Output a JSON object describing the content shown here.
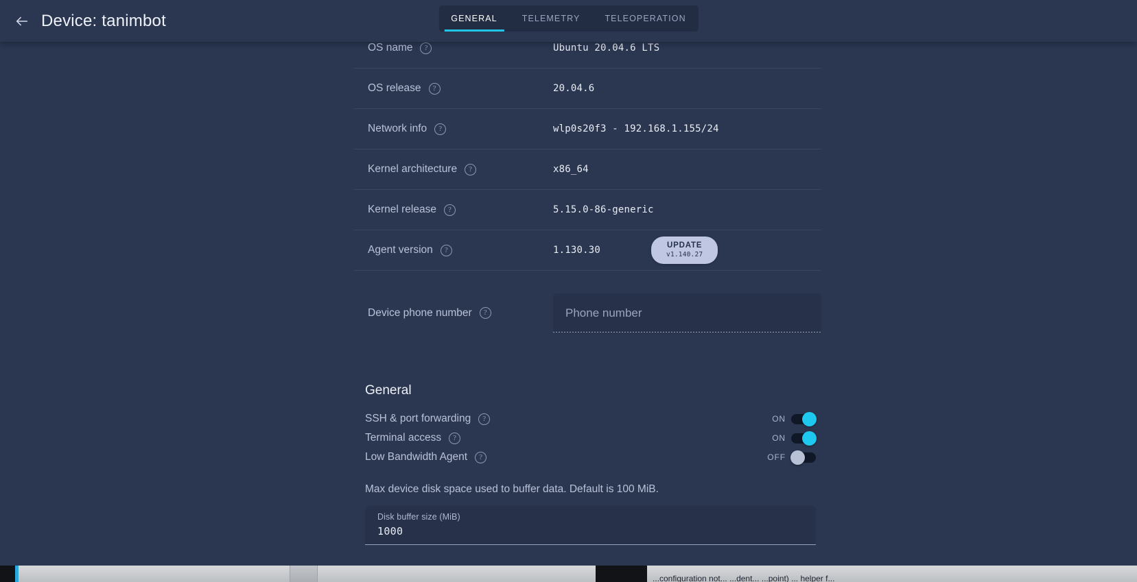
{
  "header": {
    "back_icon": "arrow-left-icon",
    "title": "Device: tanimbot",
    "tabs": [
      {
        "label": "GENERAL",
        "active": true
      },
      {
        "label": "TELEMETRY",
        "active": false
      },
      {
        "label": "TELEOPERATION",
        "active": false
      }
    ]
  },
  "info_rows": [
    {
      "label": "OS name",
      "value": "Ubuntu 20.04.6 LTS"
    },
    {
      "label": "OS release",
      "value": "20.04.6"
    },
    {
      "label": "Network info",
      "value": "wlp0s20f3 - 192.168.1.155/24"
    },
    {
      "label": "Kernel architecture",
      "value": "x86_64"
    },
    {
      "label": "Kernel release",
      "value": "5.15.0-86-generic"
    },
    {
      "label": "Agent version",
      "value": "1.130.30"
    }
  ],
  "agent_update": {
    "button_label": "UPDATE",
    "button_version": "v1.140.27"
  },
  "phone": {
    "label": "Device phone number",
    "value": "",
    "placeholder": "Phone number"
  },
  "general_section": {
    "title": "General",
    "toggles": [
      {
        "label": "SSH & port forwarding",
        "state": "ON",
        "on": true
      },
      {
        "label": "Terminal access",
        "state": "ON",
        "on": true
      },
      {
        "label": "Low Bandwidth Agent",
        "state": "OFF",
        "on": false
      }
    ],
    "buffer_hint": "Max device disk space used to buffer data. Default is 100 MiB.",
    "buffer_caption": "Disk buffer size (MiB)",
    "buffer_value": "1000"
  },
  "taskbar": {
    "clipped_text": "...configuration not... ...dent... ...point) ... helper f..."
  },
  "colors": {
    "page_background": "#2b3751",
    "tabs_background": "#222c42",
    "accent_cyan": "#22c7e8",
    "update_button": "#bfc7e2",
    "field_background": "#27314a",
    "text_primary": "#eef1f8",
    "text_secondary": "#b9c2d7",
    "divider": "#39455f"
  },
  "icons": {
    "help": "?"
  }
}
